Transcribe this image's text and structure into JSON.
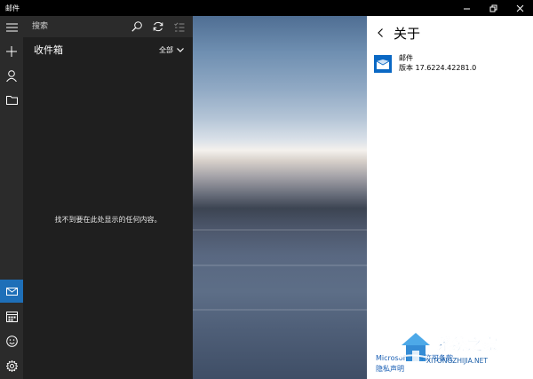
{
  "window": {
    "title": "邮件"
  },
  "search": {
    "placeholder": "搜索"
  },
  "folder": {
    "title": "收件箱",
    "filter_label": "全部"
  },
  "message_list": {
    "empty_text": "找不到要在此处显示的任何内容。"
  },
  "about": {
    "title": "关于",
    "app_name": "邮件",
    "version": "版本 17.6224.42281.0",
    "links": [
      "Microsoft 软件许可条款",
      "隐私声明"
    ]
  },
  "watermark": {
    "text": "系统之家",
    "url": "XITONGZHIJIA.NET"
  },
  "colors": {
    "accent": "#1e6fb8",
    "rail": "#2b2b2b",
    "list_bg": "#1f1f1f",
    "link": "#1a5fb4"
  }
}
